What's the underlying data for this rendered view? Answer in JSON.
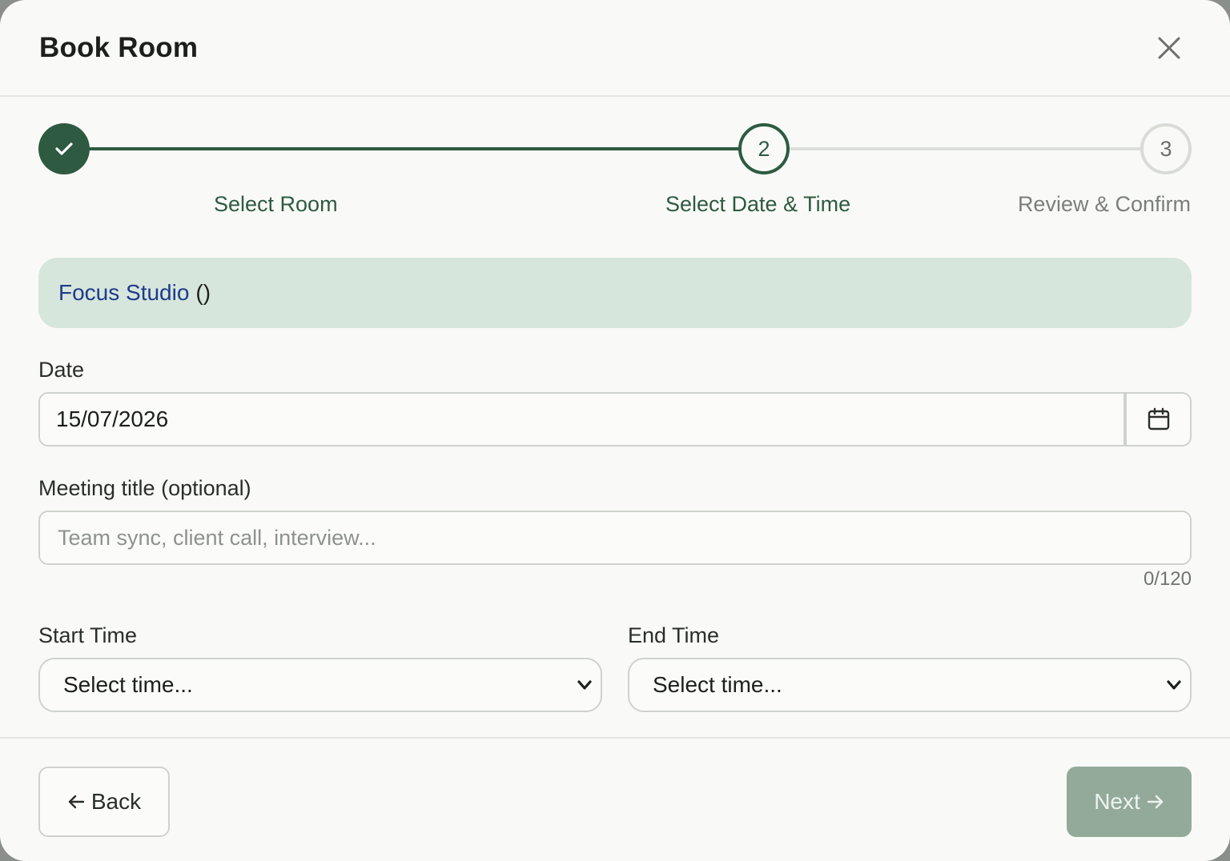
{
  "dialog": {
    "title": "Book Room",
    "close_icon": "close-icon"
  },
  "stepper": {
    "steps": [
      {
        "number": "1",
        "label": "Select Room",
        "state": "completed",
        "icon": "check-icon"
      },
      {
        "number": "2",
        "label": "Select Date & Time",
        "state": "current"
      },
      {
        "number": "3",
        "label": "Review & Confirm",
        "state": "upcoming"
      }
    ]
  },
  "room": {
    "name": "Focus Studio",
    "suffix": "()"
  },
  "form": {
    "date": {
      "label": "Date",
      "value": "15/07/2026",
      "icon": "calendar-icon"
    },
    "meeting_title": {
      "label": "Meeting title (optional)",
      "value": "",
      "placeholder": "Team sync, client call, interview...",
      "char_count": "0/120"
    },
    "start_time": {
      "label": "Start Time",
      "selected": "Select time..."
    },
    "end_time": {
      "label": "End Time",
      "selected": "Select time..."
    }
  },
  "footer": {
    "back_label": "Back",
    "next_label": "Next"
  },
  "colors": {
    "primary": "#2e5a41",
    "banner_bg": "#d6e6dc",
    "room_link": "#1f3a8a",
    "next_disabled": "#93aa9a"
  }
}
